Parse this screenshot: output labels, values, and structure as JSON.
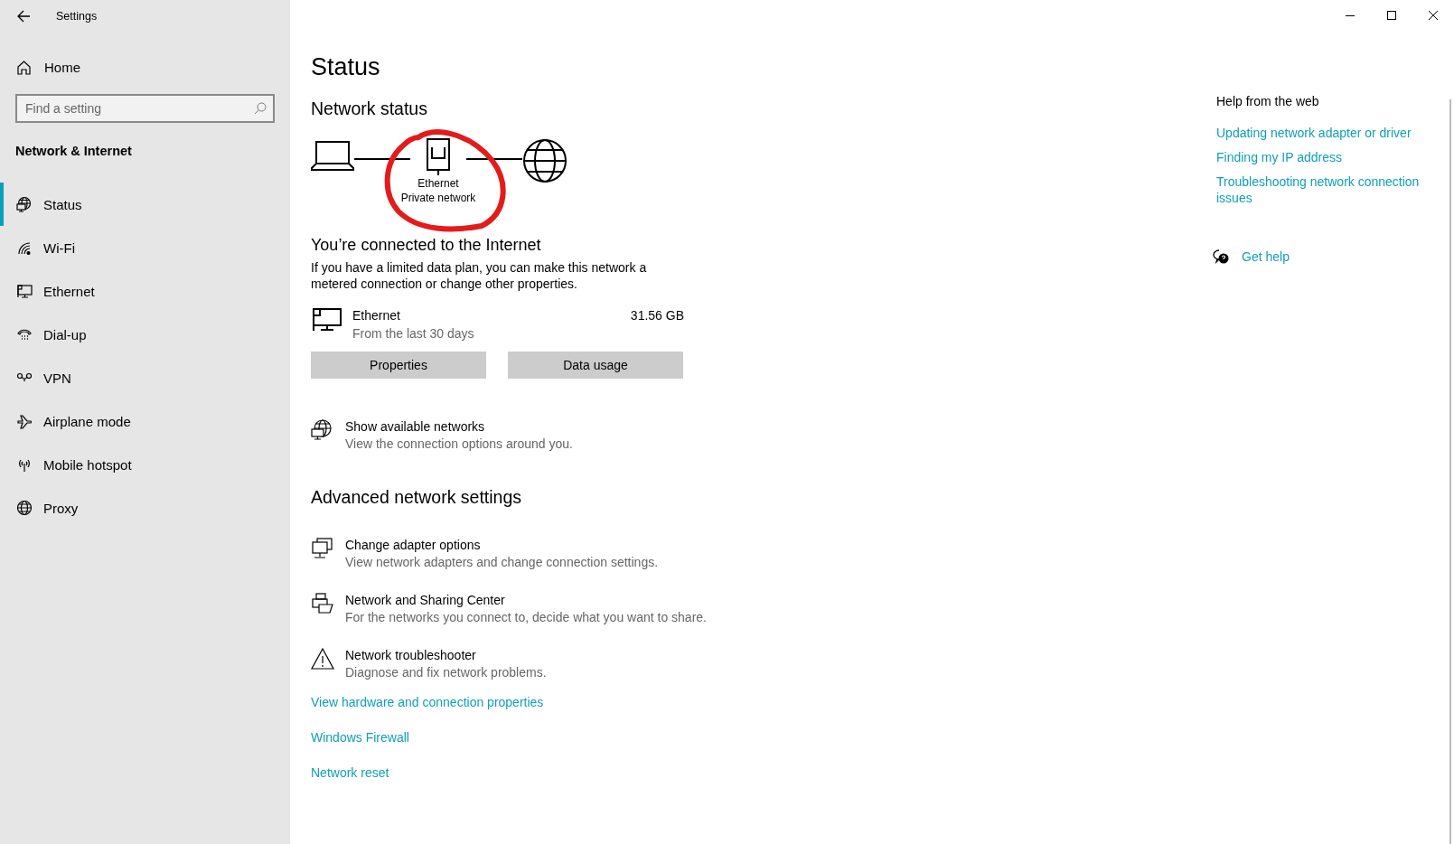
{
  "window": {
    "title": "Settings"
  },
  "sidebar": {
    "home": "Home",
    "search": {
      "placeholder": "Find a setting"
    },
    "section": "Network & Internet",
    "items": [
      {
        "label": "Status",
        "selected": true
      },
      {
        "label": "Wi-Fi",
        "selected": false
      },
      {
        "label": "Ethernet",
        "selected": false
      },
      {
        "label": "Dial-up",
        "selected": false
      },
      {
        "label": "VPN",
        "selected": false
      },
      {
        "label": "Airplane mode",
        "selected": false
      },
      {
        "label": "Mobile hotspot",
        "selected": false
      },
      {
        "label": "Proxy",
        "selected": false
      }
    ]
  },
  "page": {
    "title": "Status",
    "network_status": {
      "heading": "Network status",
      "adapter": "Ethernet",
      "network_type": "Private network"
    },
    "connection": {
      "heading": "You’re connected to the Internet",
      "description": "If you have a limited data plan, you can make this network a metered connection or change other properties."
    },
    "usage": {
      "name": "Ethernet",
      "period": "From the last 30 days",
      "amount": "31.56 GB"
    },
    "buttons": [
      "Properties",
      "Data usage"
    ],
    "show_networks": {
      "title": "Show available networks",
      "subtitle": "View the connection options around you."
    },
    "advanced": {
      "heading": "Advanced network settings",
      "items": [
        {
          "title": "Change adapter options",
          "subtitle": "View network adapters and change connection settings."
        },
        {
          "title": "Network and Sharing Center",
          "subtitle": "For the networks you connect to, decide what you want to share."
        },
        {
          "title": "Network troubleshooter",
          "subtitle": "Diagnose and fix network problems."
        }
      ],
      "links": [
        "View hardware and connection properties",
        "Windows Firewall",
        "Network reset"
      ]
    }
  },
  "help": {
    "heading": "Help from the web",
    "links": [
      "Updating network adapter or driver",
      "Finding my IP address",
      "Troubleshooting network connection issues"
    ],
    "get_help": "Get help"
  }
}
